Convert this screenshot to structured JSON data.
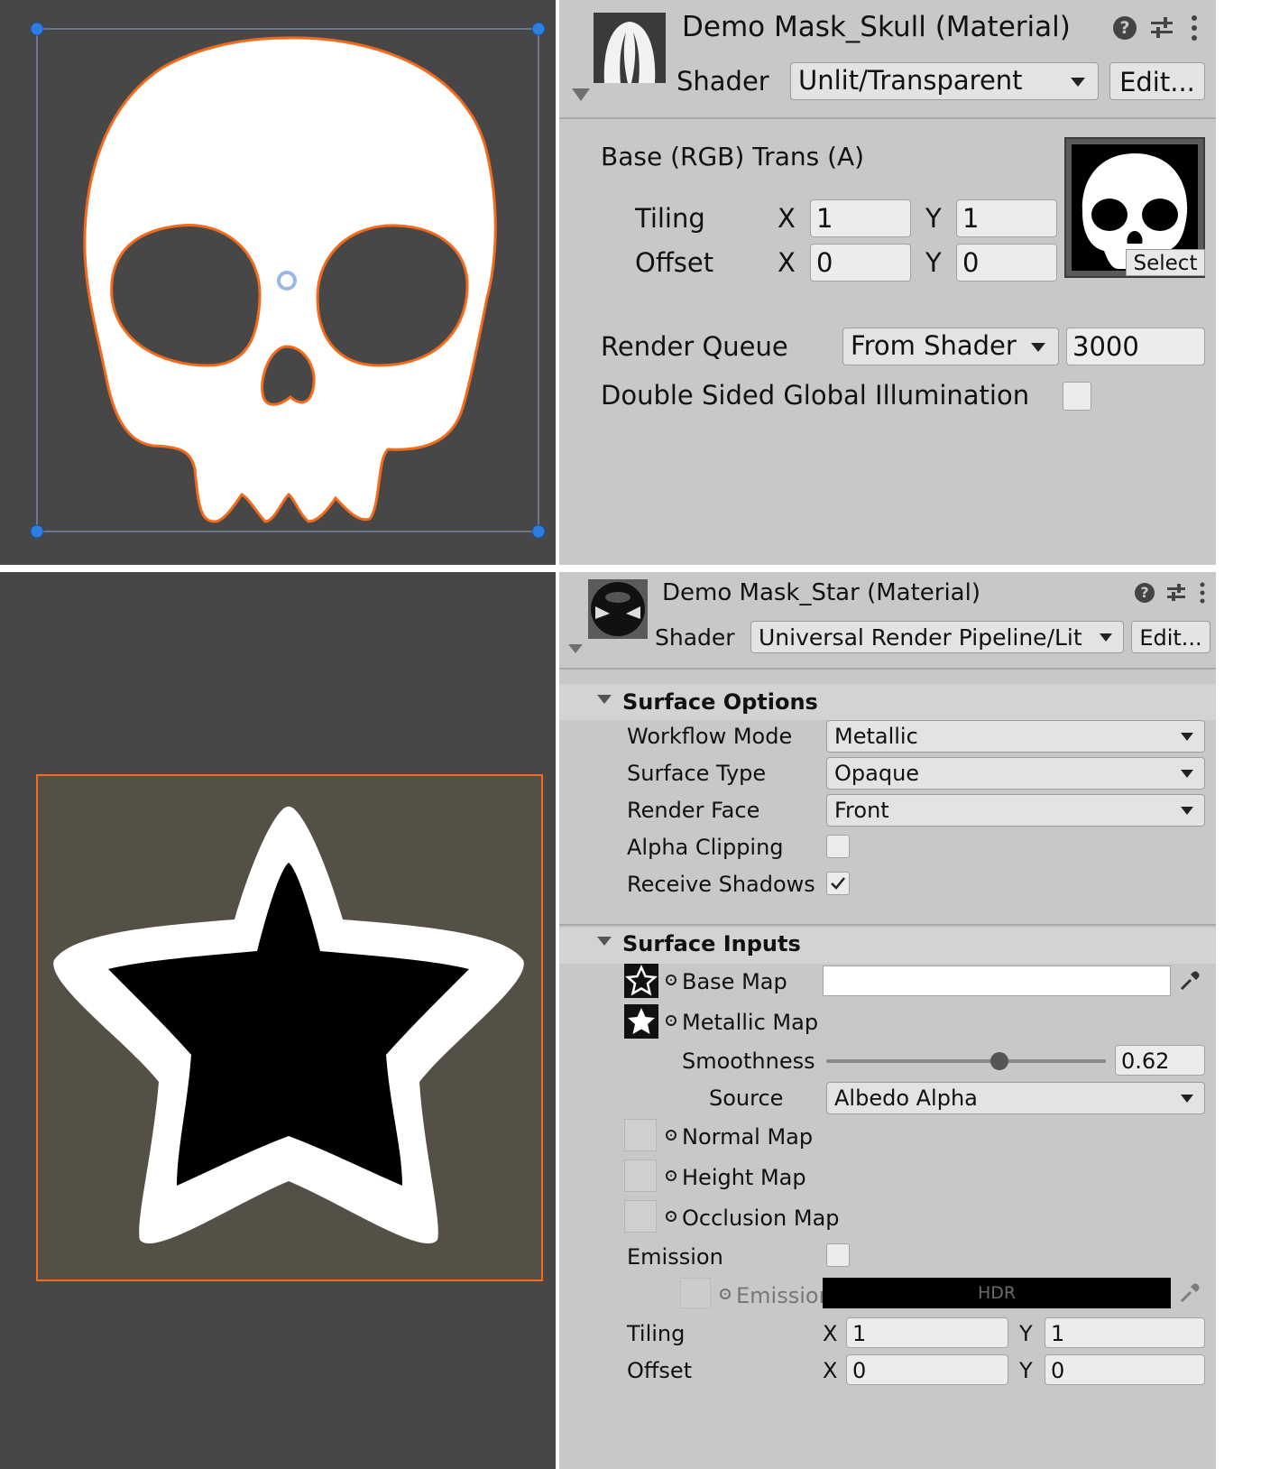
{
  "colors": {
    "scene_bg": "#474747",
    "inspector_bg": "#c8c8c8",
    "selection_outline": "#f26b1d",
    "handle_blue": "#2e7de0",
    "star_plane_bg": "#545046"
  },
  "skull_inspector": {
    "title": "Demo Mask_Skull (Material)",
    "shader_label": "Shader",
    "shader_value": "Unlit/Transparent",
    "edit_button": "Edit...",
    "base_label": "Base (RGB) Trans (A)",
    "tiling_label": "Tiling",
    "offset_label": "Offset",
    "x_label": "X",
    "y_label": "Y",
    "tiling_x": "1",
    "tiling_y": "1",
    "offset_x": "0",
    "offset_y": "0",
    "select_button": "Select",
    "render_queue_label": "Render Queue",
    "render_queue_mode": "From Shader",
    "render_queue_value": "3000",
    "double_sided_label": "Double Sided Global Illumination"
  },
  "star_inspector": {
    "title": "Demo Mask_Star (Material)",
    "shader_label": "Shader",
    "shader_value": "Universal Render Pipeline/Lit",
    "edit_button": "Edit...",
    "surface_options": {
      "header": "Surface Options",
      "workflow_mode_label": "Workflow Mode",
      "workflow_mode_value": "Metallic",
      "surface_type_label": "Surface Type",
      "surface_type_value": "Opaque",
      "render_face_label": "Render Face",
      "render_face_value": "Front",
      "alpha_clipping_label": "Alpha Clipping",
      "receive_shadows_label": "Receive Shadows"
    },
    "surface_inputs": {
      "header": "Surface Inputs",
      "base_map_label": "Base Map",
      "metallic_map_label": "Metallic Map",
      "smoothness_label": "Smoothness",
      "smoothness_value": "0.62",
      "smoothness": 0.62,
      "source_label": "Source",
      "source_value": "Albedo Alpha",
      "normal_map_label": "Normal Map",
      "height_map_label": "Height Map",
      "occlusion_map_label": "Occlusion Map",
      "emission_label": "Emission",
      "emission_map_label": "Emission",
      "hdr_label": "HDR",
      "tiling_label": "Tiling",
      "offset_label": "Offset",
      "x_label": "X",
      "y_label": "Y",
      "tiling_x": "1",
      "tiling_y": "1",
      "offset_x": "0",
      "offset_y": "0"
    }
  }
}
